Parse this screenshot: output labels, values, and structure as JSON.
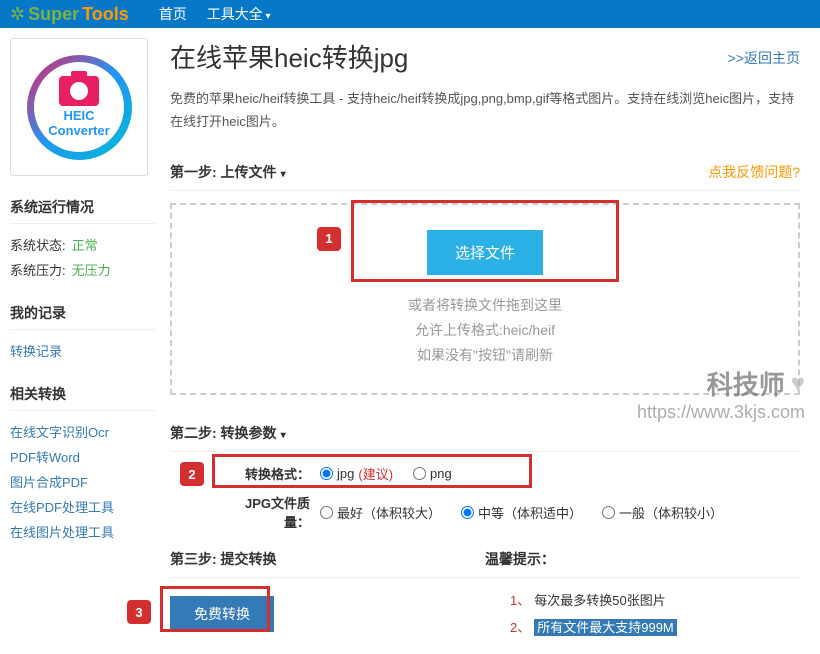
{
  "nav": {
    "logo1": "Super",
    "logo2": "Tools",
    "home": "首页",
    "tools": "工具大全"
  },
  "sidebar": {
    "converter_l1": "HEIC",
    "converter_l2": "Converter",
    "status_title": "系统运行情况",
    "status_label": "系统状态:",
    "status_value": "正常",
    "pressure_label": "系统压力:",
    "pressure_value": "无压力",
    "records_title": "我的记录",
    "records_link": "转换记录",
    "related_title": "相关转换",
    "related": [
      "在线文字识别Ocr",
      "PDF转Word",
      "图片合成PDF",
      "在线PDF处理工具",
      "在线图片处理工具"
    ]
  },
  "main": {
    "title": "在线苹果heic转换jpg",
    "back": ">>返回主页",
    "desc": "免费的苹果heic/heif转换工具 - 支持heic/heif转换成jpg,png,bmp,gif等格式图片。支持在线浏览heic图片，支持在线打开heic图片。",
    "step1": "第一步:  上传文件",
    "feedback": "点我反馈问题?",
    "select_btn": "选择文件",
    "hint1": "或者将转换文件拖到这里",
    "hint2": "允许上传格式:heic/heif",
    "hint3": "如果没有\"按钮\"请刷新",
    "step2": "第二步:  转换参数",
    "format_label": "转换格式：",
    "opt_jpg": "jpg",
    "opt_jpg_rec": "(建议)",
    "opt_png": "png",
    "quality_label": "JPG文件质量：",
    "q1": "最好（体积较大）",
    "q2": "中等（体积适中）",
    "q3": "一般（体积较小）",
    "step3": "第三步:  提交转换",
    "submit": "免费转换",
    "tips_title": "温馨提示：",
    "tip1": "每次最多转换50张图片",
    "tip2": "所有文件最大支持999M",
    "marker1": "1",
    "marker2": "2",
    "marker3": "3"
  },
  "watermark": {
    "l1": "科技师",
    "l2": "https://www.3kjs.com"
  }
}
